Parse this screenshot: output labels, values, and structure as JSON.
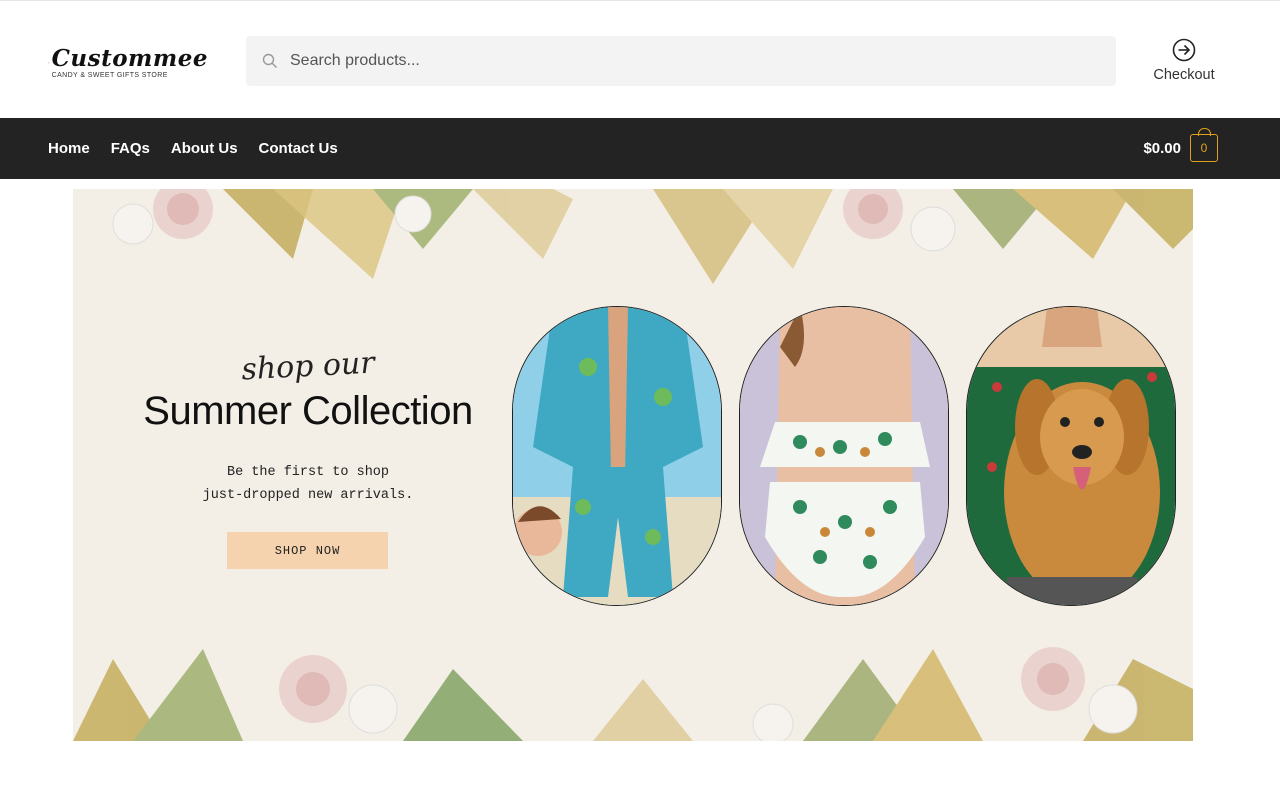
{
  "brand": {
    "name": "Custommee",
    "tagline": "CANDY & SWEET GIFTS STORE"
  },
  "search": {
    "placeholder": "Search products..."
  },
  "header": {
    "checkout_label": "Checkout"
  },
  "nav": {
    "items": [
      {
        "label": "Home"
      },
      {
        "label": "FAQs"
      },
      {
        "label": "About Us"
      },
      {
        "label": "Contact Us"
      }
    ]
  },
  "cart": {
    "total": "$0.00",
    "count": "0"
  },
  "banner": {
    "script_heading": "shop our",
    "title": "Summer Collection",
    "subtitle_line1": "Be the first to shop",
    "subtitle_line2": "just-dropped new arrivals.",
    "cta_label": "SHOP NOW",
    "products": [
      {
        "icon": "hawaiian-shirt-shorts-image"
      },
      {
        "icon": "bikini-swimsuit-image"
      },
      {
        "icon": "dog-christmas-shirt-image"
      }
    ]
  },
  "colors": {
    "nav_bg": "#232323",
    "accent": "#e0a21c",
    "cta_bg": "#f5d3ae",
    "banner_bg": "#f3efe6",
    "logo_pink": "#e8467c"
  }
}
